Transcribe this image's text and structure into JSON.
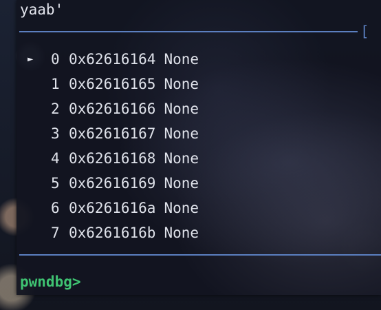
{
  "terminal": {
    "top_text": "yaab'",
    "separator_bracket": "[",
    "prompt": "pwndbg>"
  },
  "stack": {
    "current_marker": "►",
    "entries": [
      {
        "index": "0",
        "address": "0x62616164",
        "symbol": "None",
        "current": true
      },
      {
        "index": "1",
        "address": "0x62616165",
        "symbol": "None",
        "current": false
      },
      {
        "index": "2",
        "address": "0x62616166",
        "symbol": "None",
        "current": false
      },
      {
        "index": "3",
        "address": "0x62616167",
        "symbol": "None",
        "current": false
      },
      {
        "index": "4",
        "address": "0x62616168",
        "symbol": "None",
        "current": false
      },
      {
        "index": "5",
        "address": "0x62616169",
        "symbol": "None",
        "current": false
      },
      {
        "index": "6",
        "address": "0x6261616a",
        "symbol": "None",
        "current": false
      },
      {
        "index": "7",
        "address": "0x6261616b",
        "symbol": "None",
        "current": false
      }
    ]
  },
  "colors": {
    "separator": "#5b7fc0",
    "prompt": "#3fc372",
    "text": "#dfe2ea"
  }
}
